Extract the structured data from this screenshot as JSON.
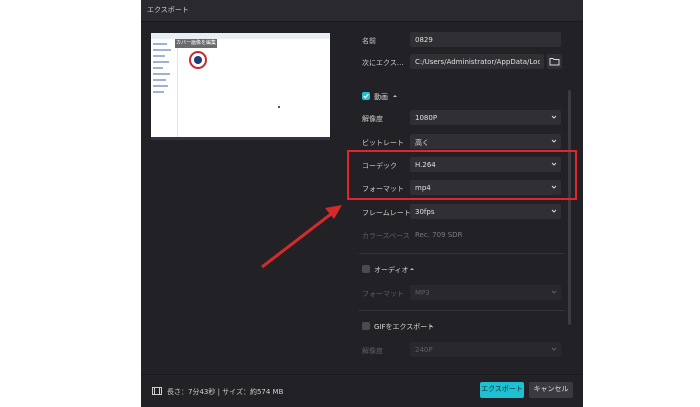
{
  "window": {
    "title": "エクスポート"
  },
  "preview": {
    "badge": "カバー画像を編集"
  },
  "form": {
    "name": {
      "label": "名前",
      "value": "0829"
    },
    "export_to": {
      "label": "次にエクス…",
      "value": "C:/Users/Administrator/AppData/Local/C..."
    },
    "video_section": {
      "label": "動画",
      "checked": true
    },
    "resolution": {
      "label": "解像度",
      "value": "1080P"
    },
    "bitrate": {
      "label": "ビットレート",
      "value": "高く"
    },
    "codec": {
      "label": "コーデック",
      "value": "H.264"
    },
    "format": {
      "label": "フォーマット",
      "value": "mp4"
    },
    "framerate": {
      "label": "フレームレート",
      "value": "30fps"
    },
    "colorspace": {
      "label": "カラースペース",
      "value": "Rec. 709 SDR"
    },
    "audio_section": {
      "label": "オーディオ",
      "checked": false
    },
    "audio_format": {
      "label": "フォーマット",
      "value": "MP3"
    },
    "gif_section": {
      "label": "GIFをエクスポート",
      "checked": false
    },
    "gif_resolution": {
      "label": "解像度",
      "value": "240P"
    }
  },
  "footer": {
    "info": "長さ：7分43秒 | サイズ：約574 MB",
    "export_label": "エクスポート",
    "cancel_label": "キャンセル"
  },
  "colors": {
    "accent": "#1ec1d1",
    "highlight": "#e0262b",
    "background": "#222226"
  }
}
